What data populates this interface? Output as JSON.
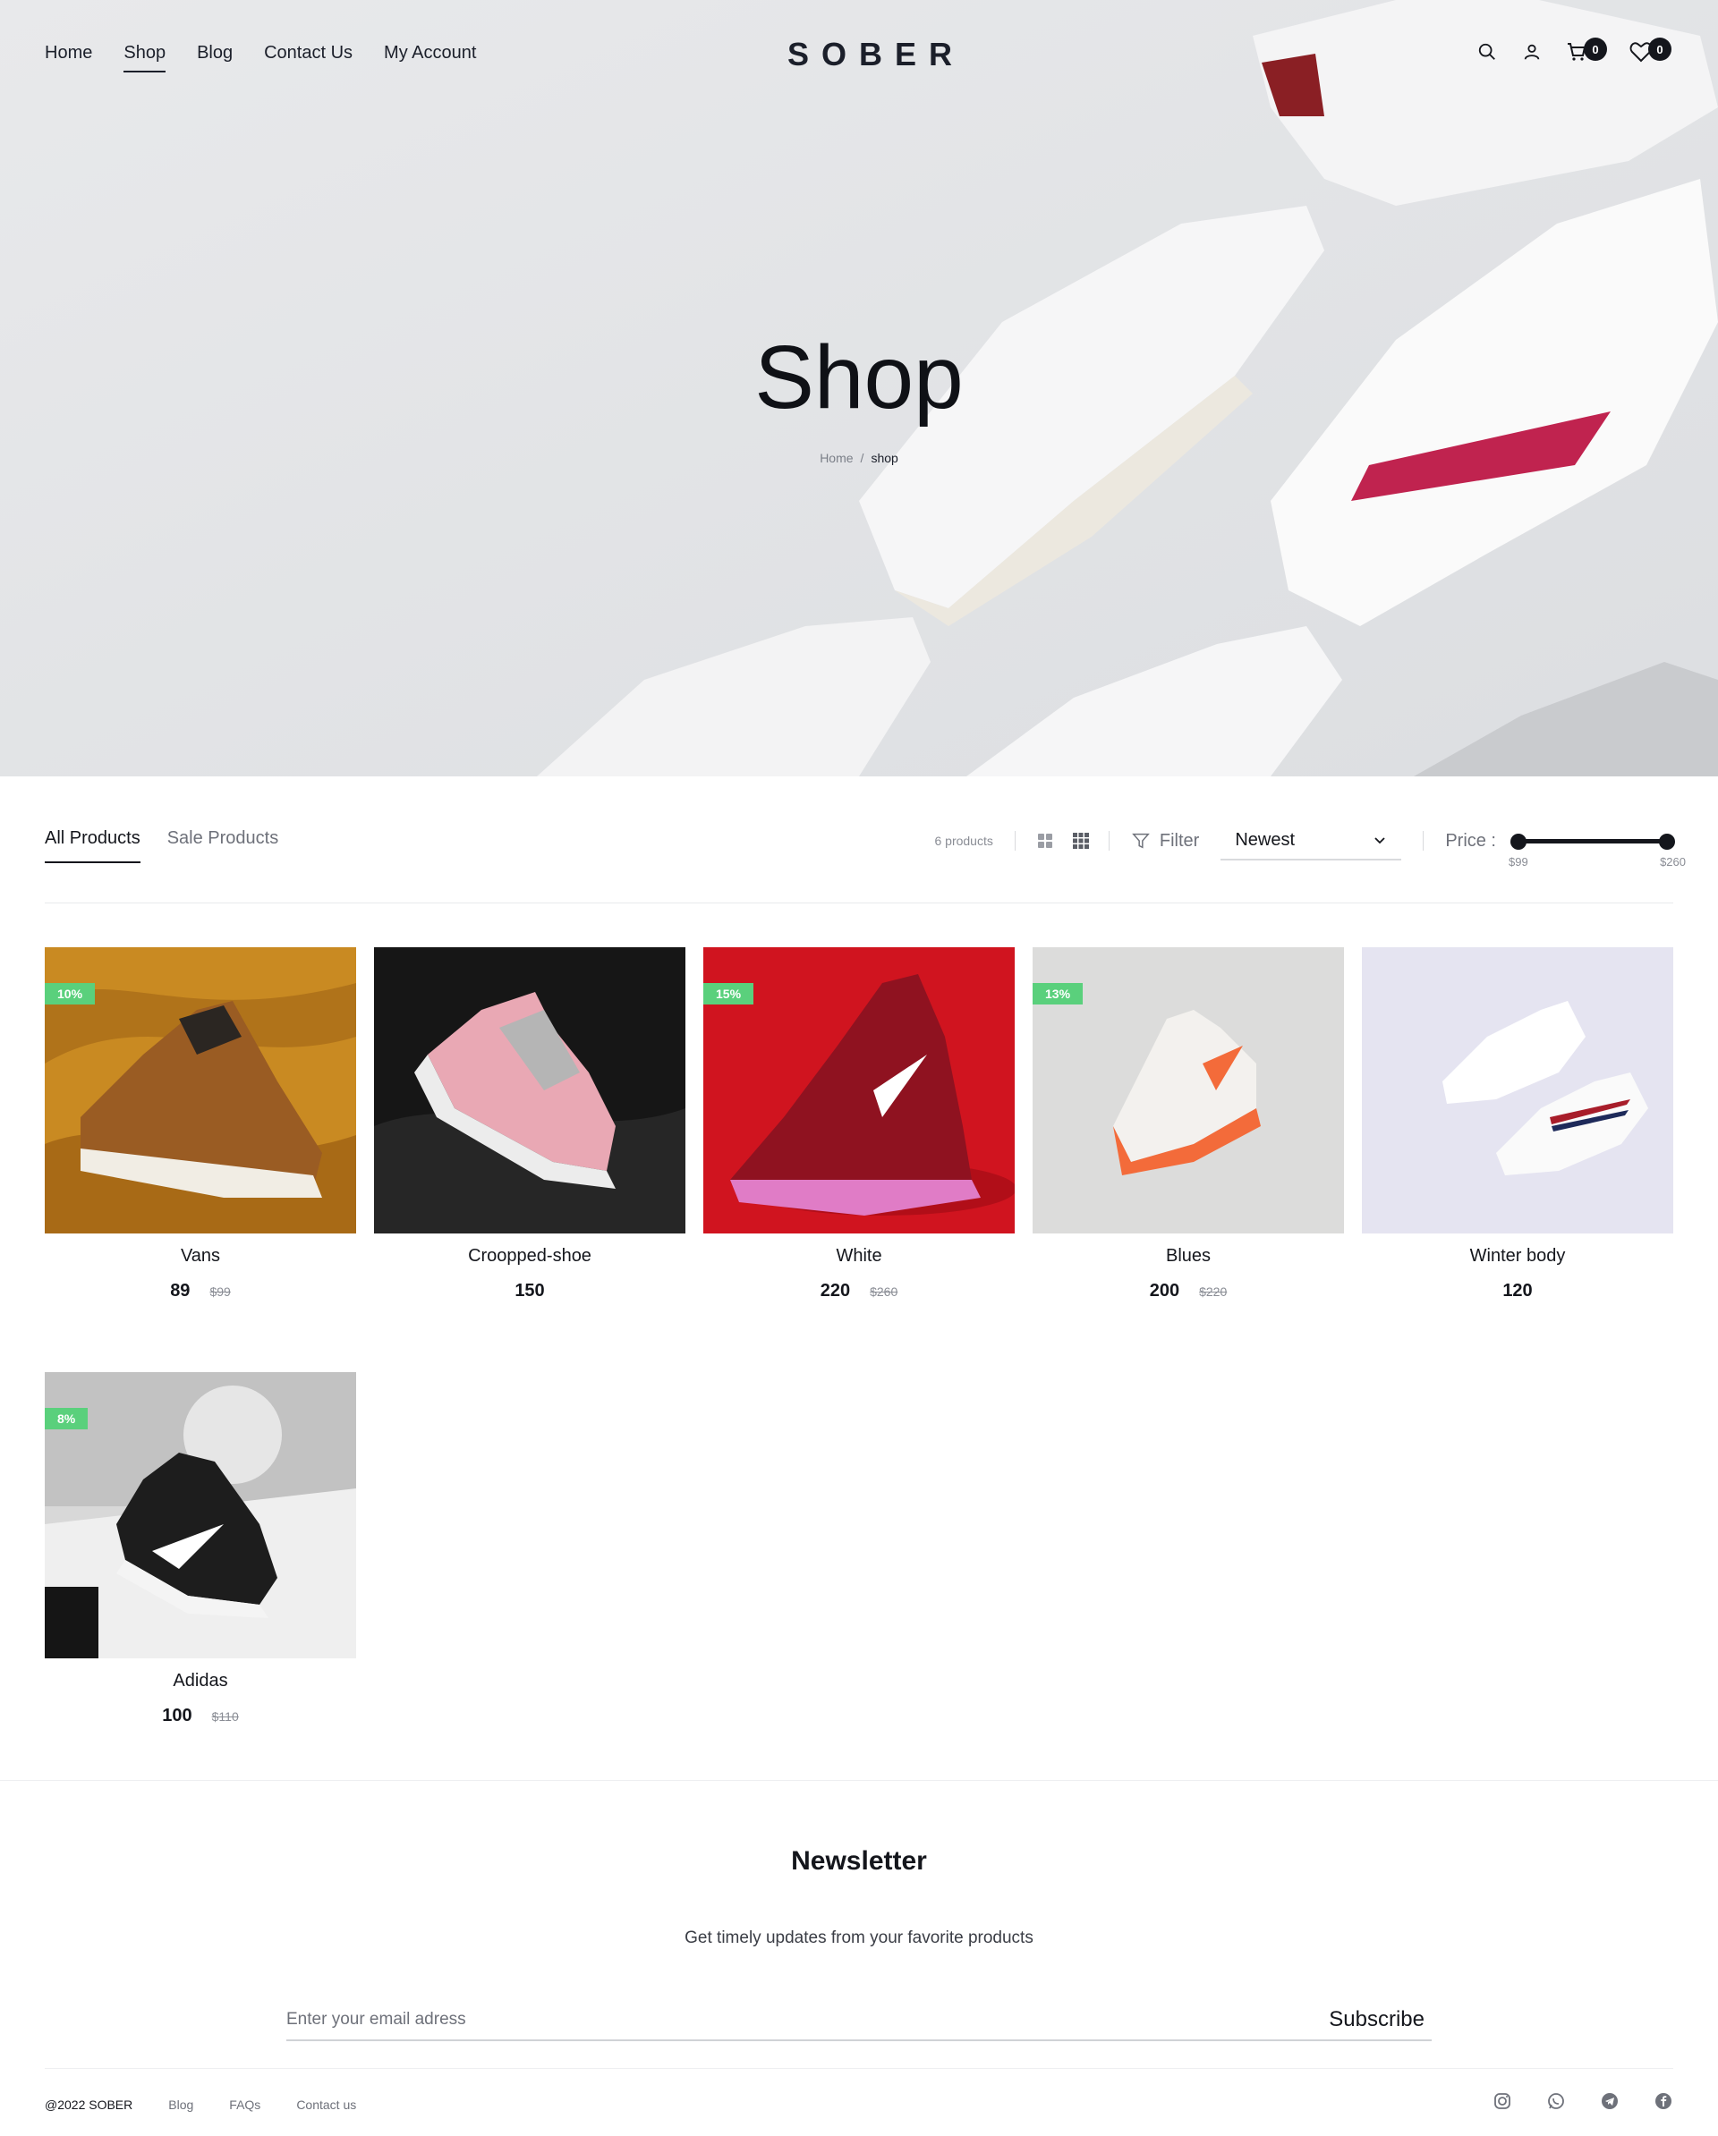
{
  "header": {
    "nav": [
      {
        "label": "Home"
      },
      {
        "label": "Shop",
        "active": true
      },
      {
        "label": "Blog"
      },
      {
        "label": "Contact Us"
      },
      {
        "label": "My Account"
      }
    ],
    "logo": "SOBER",
    "cart_count": "0",
    "wishlist_count": "0",
    "icons": [
      "search-icon",
      "user-icon",
      "cart-icon",
      "heart-icon"
    ]
  },
  "hero": {
    "title": "Shop",
    "breadcrumb": {
      "home": "Home",
      "separator": "/",
      "current": "shop"
    }
  },
  "toolbar": {
    "tabs": [
      {
        "label": "All Products",
        "active": true
      },
      {
        "label": "Sale Products"
      }
    ],
    "count": "6 products",
    "filter_label": "Filter",
    "sort_value": "Newest",
    "price_label": "Price :",
    "price_min": "$99",
    "price_max": "$260"
  },
  "products": [
    {
      "name": "Vans",
      "price": "89",
      "old_price": "$99",
      "discount": "10%"
    },
    {
      "name": "Croopped-shoe",
      "price": "150",
      "old_price": "",
      "discount": ""
    },
    {
      "name": "White",
      "price": "220",
      "old_price": "$260",
      "discount": "15%"
    },
    {
      "name": "Blues",
      "price": "200",
      "old_price": "$220",
      "discount": "13%"
    },
    {
      "name": "Winter body",
      "price": "120",
      "old_price": "",
      "discount": ""
    },
    {
      "name": "Adidas",
      "price": "100",
      "old_price": "$110",
      "discount": "8%"
    }
  ],
  "newsletter": {
    "title": "Newsletter",
    "subtitle": "Get timely updates from your favorite products",
    "placeholder": "Enter your email adress",
    "button": "Subscribe"
  },
  "footer": {
    "copyright": "@2022 SOBER",
    "links": [
      "Blog",
      "FAQs",
      "Contact us"
    ],
    "social": [
      "instagram-icon",
      "whatsapp-icon",
      "telegram-icon",
      "facebook-icon"
    ]
  },
  "colors": {
    "accent": "#14161c",
    "sale_badge": "#5ad07c",
    "hero_bg": "#e4e5e7"
  }
}
